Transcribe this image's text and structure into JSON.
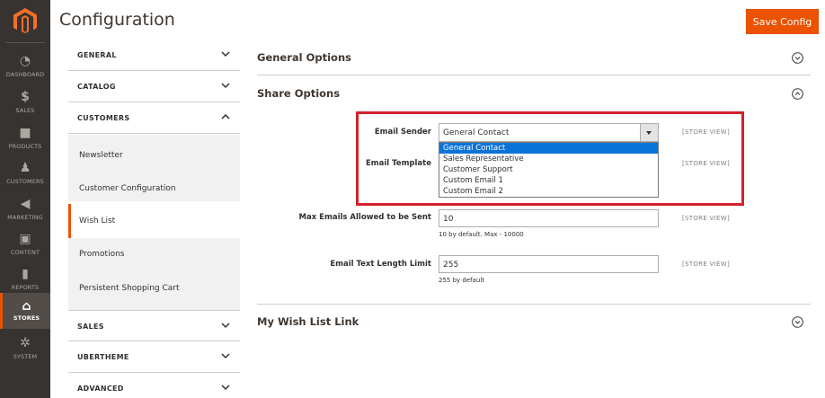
{
  "nav": {
    "items": [
      {
        "label": "DASHBOARD",
        "icon": "dashboard-icon",
        "glyph": "◔"
      },
      {
        "label": "SALES",
        "icon": "dollar-icon",
        "glyph": "$"
      },
      {
        "label": "PRODUCTS",
        "icon": "cube-icon",
        "glyph": "■"
      },
      {
        "label": "CUSTOMERS",
        "icon": "person-icon",
        "glyph": "♟"
      },
      {
        "label": "MARKETING",
        "icon": "megaphone-icon",
        "glyph": "◀"
      },
      {
        "label": "CONTENT",
        "icon": "content-icon",
        "glyph": "▣"
      },
      {
        "label": "REPORTS",
        "icon": "bar-chart-icon",
        "glyph": "▮"
      },
      {
        "label": "STORES",
        "icon": "store-icon",
        "glyph": "⌂"
      },
      {
        "label": "SYSTEM",
        "icon": "gear-icon",
        "glyph": "✲"
      }
    ],
    "accent": "#eb5202"
  },
  "header": {
    "title": "Configuration",
    "save_label": "Save Config"
  },
  "tabs": {
    "general": "GENERAL",
    "catalog": "CATALOG",
    "customers": "CUSTOMERS",
    "customers_items": [
      "Newsletter",
      "Customer Configuration",
      "Wish List",
      "Promotions",
      "Persistent Shopping Cart"
    ],
    "sales": "SALES",
    "ubertheme": "UBERTHEME",
    "advanced": "ADVANCED"
  },
  "main": {
    "general_options": "General Options",
    "share_options": "Share Options",
    "email_sender": {
      "label": "Email Sender",
      "value": "General Contact",
      "options": [
        "General Contact",
        "Sales Representative",
        "Customer Support",
        "Custom Email 1",
        "Custom Email 2"
      ],
      "scope": "[STORE VIEW]"
    },
    "email_template": {
      "label": "Email Template",
      "scope": "[STORE VIEW]"
    },
    "max_emails": {
      "label": "Max Emails Allowed to be Sent",
      "value": "10",
      "note": "10 by default. Max - 10000",
      "scope": "[STORE VIEW]"
    },
    "text_length": {
      "label": "Email Text Length Limit",
      "value": "255",
      "note": "255 by default",
      "scope": "[STORE VIEW]"
    },
    "wishlist_link": "My Wish List Link"
  }
}
